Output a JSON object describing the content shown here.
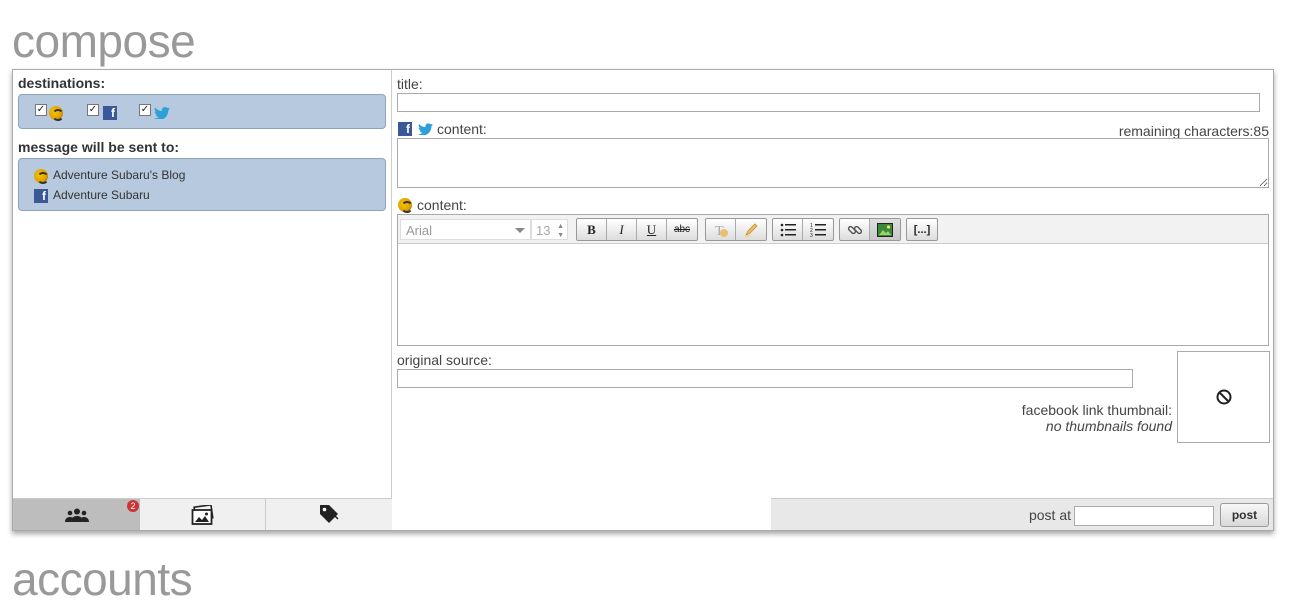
{
  "headings": {
    "compose": "compose",
    "accounts": "accounts"
  },
  "destinations": {
    "label": "destinations:",
    "items": [
      {
        "icon": "blog-icon",
        "checked": true
      },
      {
        "icon": "facebook-icon",
        "checked": true
      },
      {
        "icon": "twitter-icon",
        "checked": true
      }
    ]
  },
  "recipients": {
    "label": "message will be sent to:",
    "items": [
      {
        "icon": "blog-icon",
        "name": "Adventure Subaru's Blog"
      },
      {
        "icon": "facebook-icon",
        "name": "Adventure Subaru"
      }
    ]
  },
  "form": {
    "title_label": "title:",
    "title_value": "",
    "social_content_label": "content:",
    "remaining_label": "remaining characters:85",
    "blog_content_label": "content:",
    "font_family": "Arial",
    "font_size": "13",
    "toolbar_buttons": {
      "bold": "B",
      "italic": "I",
      "underline": "U",
      "strike": "abc",
      "more": "[...]"
    },
    "source_label": "original source:",
    "source_value": "",
    "thumbnail_label": "facebook link thumbnail:",
    "thumbnail_status": "no thumbnails found"
  },
  "footer": {
    "badge_count": "2",
    "post_at_label": "post at",
    "post_at_value": "",
    "post_button": "post"
  },
  "colors": {
    "heading": "#999999",
    "blue_box": "#b7c9de",
    "facebook": "#3b5998",
    "twitter": "#2d9fd9",
    "badge": "#cc3333"
  }
}
